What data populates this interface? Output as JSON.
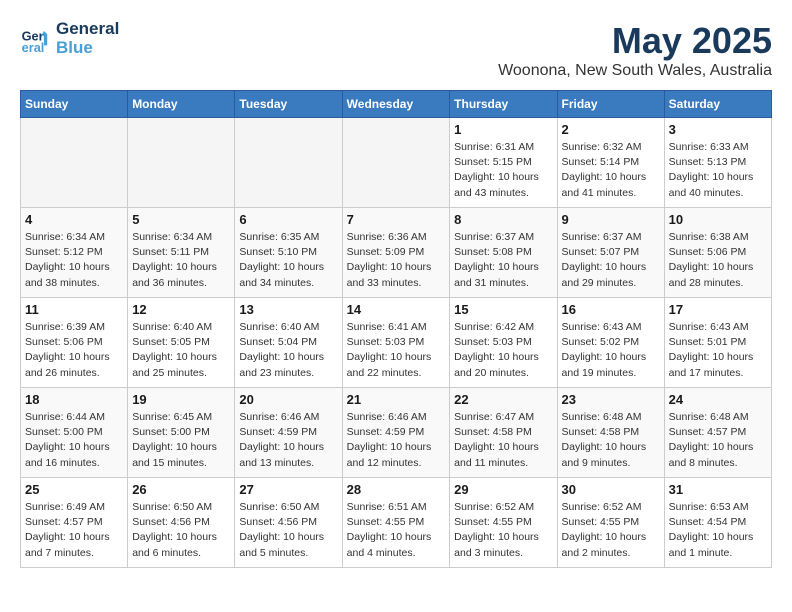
{
  "header": {
    "logo_line1": "General",
    "logo_line2": "Blue",
    "month_title": "May 2025",
    "location": "Woonona, New South Wales, Australia"
  },
  "weekdays": [
    "Sunday",
    "Monday",
    "Tuesday",
    "Wednesday",
    "Thursday",
    "Friday",
    "Saturday"
  ],
  "weeks": [
    [
      {
        "day": "",
        "info": ""
      },
      {
        "day": "",
        "info": ""
      },
      {
        "day": "",
        "info": ""
      },
      {
        "day": "",
        "info": ""
      },
      {
        "day": "1",
        "info": "Sunrise: 6:31 AM\nSunset: 5:15 PM\nDaylight: 10 hours\nand 43 minutes."
      },
      {
        "day": "2",
        "info": "Sunrise: 6:32 AM\nSunset: 5:14 PM\nDaylight: 10 hours\nand 41 minutes."
      },
      {
        "day": "3",
        "info": "Sunrise: 6:33 AM\nSunset: 5:13 PM\nDaylight: 10 hours\nand 40 minutes."
      }
    ],
    [
      {
        "day": "4",
        "info": "Sunrise: 6:34 AM\nSunset: 5:12 PM\nDaylight: 10 hours\nand 38 minutes."
      },
      {
        "day": "5",
        "info": "Sunrise: 6:34 AM\nSunset: 5:11 PM\nDaylight: 10 hours\nand 36 minutes."
      },
      {
        "day": "6",
        "info": "Sunrise: 6:35 AM\nSunset: 5:10 PM\nDaylight: 10 hours\nand 34 minutes."
      },
      {
        "day": "7",
        "info": "Sunrise: 6:36 AM\nSunset: 5:09 PM\nDaylight: 10 hours\nand 33 minutes."
      },
      {
        "day": "8",
        "info": "Sunrise: 6:37 AM\nSunset: 5:08 PM\nDaylight: 10 hours\nand 31 minutes."
      },
      {
        "day": "9",
        "info": "Sunrise: 6:37 AM\nSunset: 5:07 PM\nDaylight: 10 hours\nand 29 minutes."
      },
      {
        "day": "10",
        "info": "Sunrise: 6:38 AM\nSunset: 5:06 PM\nDaylight: 10 hours\nand 28 minutes."
      }
    ],
    [
      {
        "day": "11",
        "info": "Sunrise: 6:39 AM\nSunset: 5:06 PM\nDaylight: 10 hours\nand 26 minutes."
      },
      {
        "day": "12",
        "info": "Sunrise: 6:40 AM\nSunset: 5:05 PM\nDaylight: 10 hours\nand 25 minutes."
      },
      {
        "day": "13",
        "info": "Sunrise: 6:40 AM\nSunset: 5:04 PM\nDaylight: 10 hours\nand 23 minutes."
      },
      {
        "day": "14",
        "info": "Sunrise: 6:41 AM\nSunset: 5:03 PM\nDaylight: 10 hours\nand 22 minutes."
      },
      {
        "day": "15",
        "info": "Sunrise: 6:42 AM\nSunset: 5:03 PM\nDaylight: 10 hours\nand 20 minutes."
      },
      {
        "day": "16",
        "info": "Sunrise: 6:43 AM\nSunset: 5:02 PM\nDaylight: 10 hours\nand 19 minutes."
      },
      {
        "day": "17",
        "info": "Sunrise: 6:43 AM\nSunset: 5:01 PM\nDaylight: 10 hours\nand 17 minutes."
      }
    ],
    [
      {
        "day": "18",
        "info": "Sunrise: 6:44 AM\nSunset: 5:00 PM\nDaylight: 10 hours\nand 16 minutes."
      },
      {
        "day": "19",
        "info": "Sunrise: 6:45 AM\nSunset: 5:00 PM\nDaylight: 10 hours\nand 15 minutes."
      },
      {
        "day": "20",
        "info": "Sunrise: 6:46 AM\nSunset: 4:59 PM\nDaylight: 10 hours\nand 13 minutes."
      },
      {
        "day": "21",
        "info": "Sunrise: 6:46 AM\nSunset: 4:59 PM\nDaylight: 10 hours\nand 12 minutes."
      },
      {
        "day": "22",
        "info": "Sunrise: 6:47 AM\nSunset: 4:58 PM\nDaylight: 10 hours\nand 11 minutes."
      },
      {
        "day": "23",
        "info": "Sunrise: 6:48 AM\nSunset: 4:58 PM\nDaylight: 10 hours\nand 9 minutes."
      },
      {
        "day": "24",
        "info": "Sunrise: 6:48 AM\nSunset: 4:57 PM\nDaylight: 10 hours\nand 8 minutes."
      }
    ],
    [
      {
        "day": "25",
        "info": "Sunrise: 6:49 AM\nSunset: 4:57 PM\nDaylight: 10 hours\nand 7 minutes."
      },
      {
        "day": "26",
        "info": "Sunrise: 6:50 AM\nSunset: 4:56 PM\nDaylight: 10 hours\nand 6 minutes."
      },
      {
        "day": "27",
        "info": "Sunrise: 6:50 AM\nSunset: 4:56 PM\nDaylight: 10 hours\nand 5 minutes."
      },
      {
        "day": "28",
        "info": "Sunrise: 6:51 AM\nSunset: 4:55 PM\nDaylight: 10 hours\nand 4 minutes."
      },
      {
        "day": "29",
        "info": "Sunrise: 6:52 AM\nSunset: 4:55 PM\nDaylight: 10 hours\nand 3 minutes."
      },
      {
        "day": "30",
        "info": "Sunrise: 6:52 AM\nSunset: 4:55 PM\nDaylight: 10 hours\nand 2 minutes."
      },
      {
        "day": "31",
        "info": "Sunrise: 6:53 AM\nSunset: 4:54 PM\nDaylight: 10 hours\nand 1 minute."
      }
    ]
  ]
}
